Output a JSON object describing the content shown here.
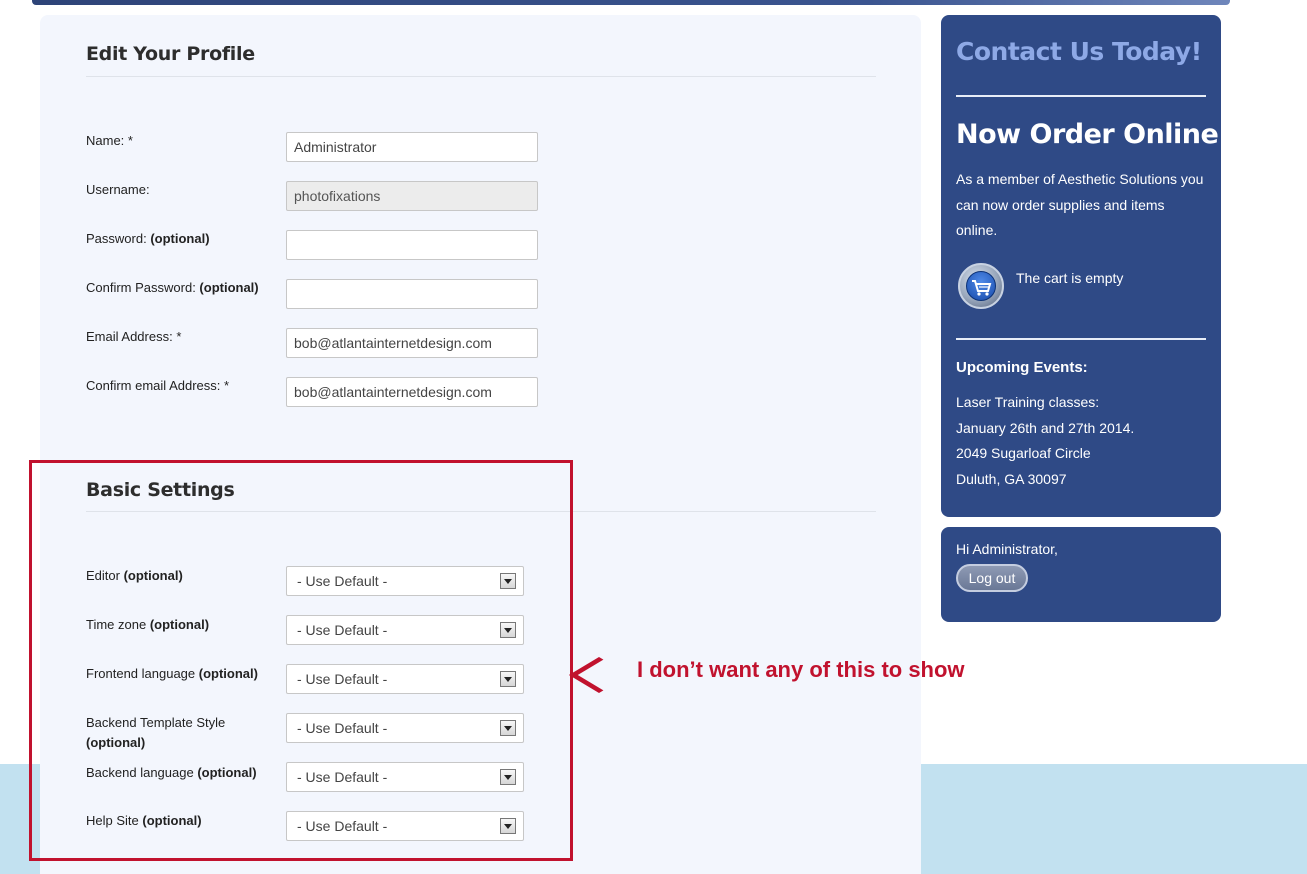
{
  "profile": {
    "title": "Edit Your Profile",
    "fields": [
      {
        "label": "Name: *",
        "optional": "",
        "value": "Administrator",
        "disabled": false
      },
      {
        "label": "Username:",
        "optional": "",
        "value": "photofixations",
        "disabled": true
      },
      {
        "label": "Password: ",
        "optional": "(optional)",
        "value": "",
        "disabled": false
      },
      {
        "label": "Confirm Password: ",
        "optional": "(optional)",
        "value": "",
        "disabled": false
      },
      {
        "label": "Email Address: *",
        "optional": "",
        "value": "bob@atlantainternetdesign.com",
        "disabled": false
      },
      {
        "label": "Confirm email Address: *",
        "optional": "",
        "value": "bob@atlantainternetdesign.com",
        "disabled": false
      }
    ]
  },
  "basic_settings": {
    "title": "Basic Settings",
    "fields": [
      {
        "label": "Editor ",
        "optional": "(optional)",
        "value": "- Use Default -"
      },
      {
        "label": "Time zone ",
        "optional": "(optional)",
        "value": "- Use Default -"
      },
      {
        "label": "Frontend language ",
        "optional": "(optional)",
        "value": "- Use Default -"
      },
      {
        "label": "Backend Template Style ",
        "optional": "(optional)",
        "value": "- Use Default -"
      },
      {
        "label": "Backend language ",
        "optional": "(optional)",
        "value": "- Use Default -"
      },
      {
        "label": "Help Site ",
        "optional": "(optional)",
        "value": "- Use Default -"
      }
    ]
  },
  "annotation": {
    "text": "I don’t want any of this to show",
    "color": "#c1122e"
  },
  "sidebar": {
    "contact_title": "Contact Us Today!",
    "order_title": "Now Order Online!",
    "order_text": "As a member of Aesthetic Solutions you can now order supplies and items online.",
    "cart_icon": "shopping-cart-icon",
    "cart_text": "The cart is empty",
    "events_title": "Upcoming Events:",
    "events_lines": [
      "Laser Training classes:",
      "January 26th and 27th 2014.",
      "2049 Sugarloaf Circle",
      "Duluth, GA 30097"
    ],
    "panel_color": "#2f4a86"
  },
  "login": {
    "greeting": "Hi Administrator,",
    "logout_label": "Log out"
  }
}
